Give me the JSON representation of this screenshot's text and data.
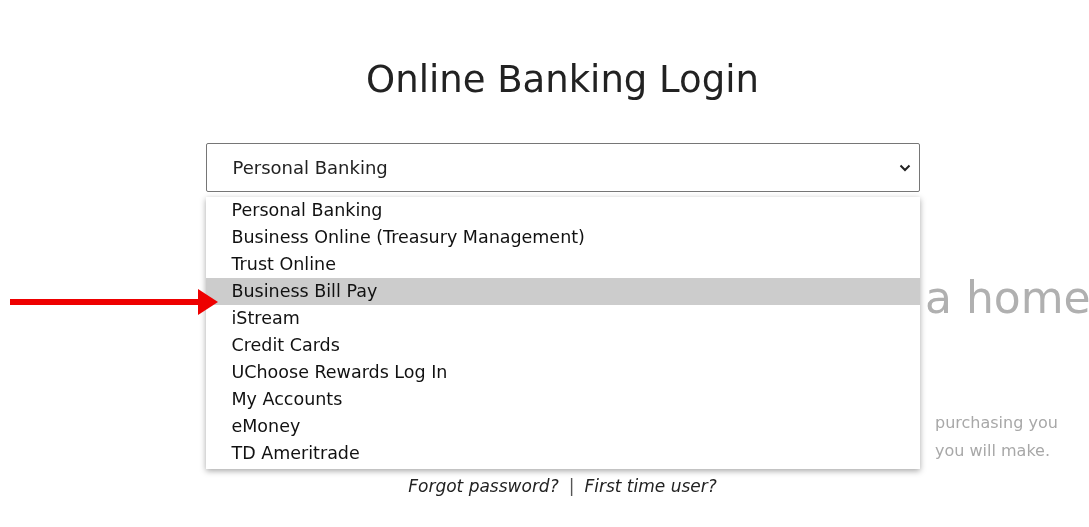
{
  "title": "Online Banking Login",
  "login_type_select": {
    "value": "Personal Banking",
    "expanded": true
  },
  "dropdown_options": [
    {
      "label": "Personal Banking",
      "selected": false
    },
    {
      "label": "Business Online (Treasury Management)",
      "selected": false
    },
    {
      "label": "Trust Online",
      "selected": false
    },
    {
      "label": "Business Bill Pay",
      "selected": true
    },
    {
      "label": "iStream",
      "selected": false
    },
    {
      "label": "Credit Cards",
      "selected": false
    },
    {
      "label": "UChoose Rewards Log In",
      "selected": false
    },
    {
      "label": "My Accounts",
      "selected": false
    },
    {
      "label": "eMoney",
      "selected": false
    },
    {
      "label": "TD Ameritrade",
      "selected": false
    }
  ],
  "links": [
    "Forgot password?",
    "First time user?"
  ],
  "link_separator": "|",
  "background_hero": {
    "heading": "a home",
    "lines": [
      "purchasing you",
      "you will make."
    ]
  }
}
